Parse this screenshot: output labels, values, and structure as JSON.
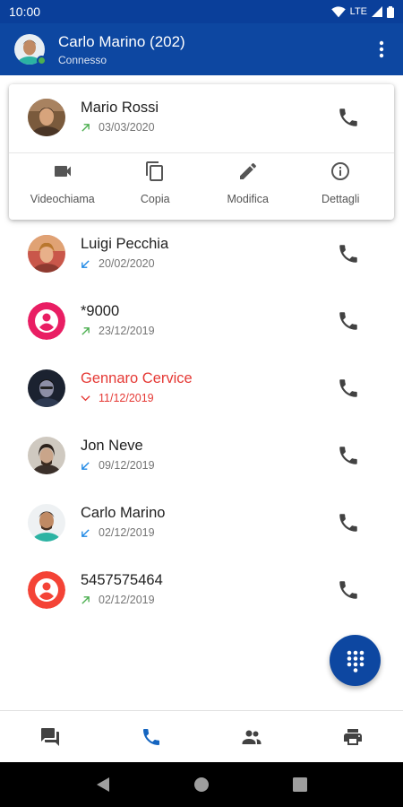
{
  "status_bar": {
    "time": "10:00",
    "network": "LTE"
  },
  "app_bar": {
    "user_name": "Carlo Marino (202)",
    "user_status": "Connesso",
    "more_icon": "more-vert-icon"
  },
  "expanded_call": {
    "name": "Mario Rossi",
    "date": "03/03/2020",
    "direction": "outgoing",
    "actions": [
      {
        "label": "Videochiama",
        "icon": "videocam-icon"
      },
      {
        "label": "Copia",
        "icon": "copy-icon"
      },
      {
        "label": "Modifica",
        "icon": "edit-icon"
      },
      {
        "label": "Dettagli",
        "icon": "info-icon"
      }
    ]
  },
  "calls": [
    {
      "name": "Luigi Pecchia",
      "date": "20/02/2020",
      "direction": "incoming",
      "avatar": "photo"
    },
    {
      "name": "*9000",
      "date": "23/12/2019",
      "direction": "outgoing",
      "avatar": "placeholder",
      "avatar_color": "#e91e63"
    },
    {
      "name": "Gennaro Cervice",
      "date": "11/12/2019",
      "direction": "missed",
      "avatar": "photo"
    },
    {
      "name": "Jon Neve",
      "date": "09/12/2019",
      "direction": "incoming",
      "avatar": "photo"
    },
    {
      "name": "Carlo Marino",
      "date": "02/12/2019",
      "direction": "incoming",
      "avatar": "photo"
    },
    {
      "name": "5457575464",
      "date": "02/12/2019",
      "direction": "outgoing",
      "avatar": "placeholder",
      "avatar_color": "#f44336"
    }
  ],
  "bottom_nav": [
    {
      "icon": "chat-icon",
      "active": false
    },
    {
      "icon": "phone-icon",
      "active": true
    },
    {
      "icon": "contacts-icon",
      "active": false
    },
    {
      "icon": "printer-icon",
      "active": false
    }
  ],
  "colors": {
    "primary": "#0d47a1",
    "outgoing": "#4caf50",
    "incoming": "#1e88e5",
    "missed": "#e53935",
    "active_nav": "#1565c0"
  }
}
